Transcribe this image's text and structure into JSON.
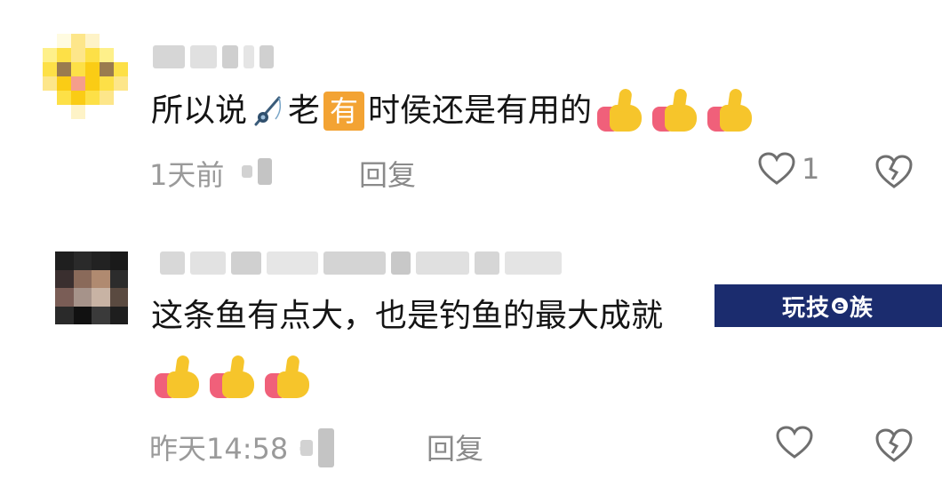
{
  "comments": [
    {
      "text_segments": [
        "所以说",
        "老",
        "时侯还是有用的"
      ],
      "inline_badge": "有",
      "inline_icon": "fishing-rod-icon",
      "emoji": "thumbs-up-icon",
      "emoji_count": 3,
      "time": "1天前",
      "reply_label": "回复",
      "like_count": "1"
    },
    {
      "text_line1": "这条鱼有点大，也是钓鱼的最大成就",
      "emoji": "thumbs-up-icon",
      "emoji_count": 3,
      "time": "昨天14:58 ·",
      "reply_label": "回复"
    }
  ],
  "watermark": {
    "text_before": "玩技",
    "logo_letter": "e",
    "text_after": "族"
  },
  "colors": {
    "badge": "#f3a333",
    "watermark_bg": "#1b2c6e",
    "meta_text": "#9a9a9a"
  }
}
